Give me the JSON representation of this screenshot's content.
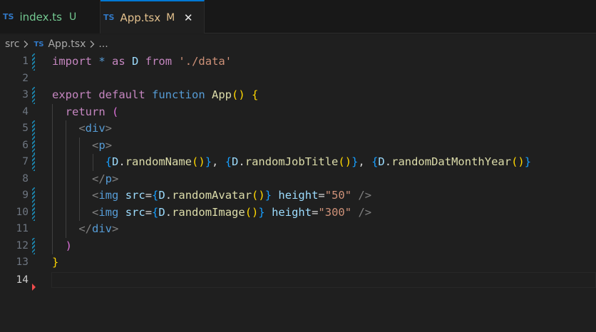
{
  "tabs": [
    {
      "badge": "TS",
      "label": "index.ts",
      "status": "U"
    },
    {
      "badge": "TS",
      "label": "App.tsx",
      "status": "M",
      "close": "✕"
    }
  ],
  "breadcrumb": {
    "folder": "src",
    "badge": "TS",
    "file": "App.tsx",
    "more": "..."
  },
  "editor": {
    "line_numbers": [
      "1",
      "2",
      "3",
      "4",
      "5",
      "6",
      "7",
      "8",
      "9",
      "10",
      "11",
      "12",
      "13",
      "14"
    ],
    "lines": [
      {
        "t": [
          "import",
          "*",
          "as",
          "D",
          "from",
          "'./data'"
        ]
      },
      {
        "t": []
      },
      {
        "t": [
          "export",
          "default",
          "function",
          "App",
          "()",
          "{"
        ]
      },
      {
        "t": [
          "return",
          "("
        ]
      },
      {
        "t": [
          "<",
          "div",
          ">"
        ]
      },
      {
        "t": [
          "<",
          "p",
          ">"
        ]
      },
      {
        "t": [
          "{",
          "D",
          ".",
          "randomName",
          "()",
          "}",
          ", ",
          "{",
          "D",
          ".",
          "randomJobTitle",
          "()",
          "}",
          ", ",
          "{",
          "D",
          ".",
          "randomDatMonthYear",
          "()",
          "}"
        ]
      },
      {
        "t": [
          "</",
          "p",
          ">"
        ]
      },
      {
        "t": [
          "<",
          "img",
          "src",
          "=",
          "{",
          "D",
          ".",
          "randomAvatar",
          "()",
          "}",
          "height",
          "=",
          "\"50\"",
          "/>"
        ]
      },
      {
        "t": [
          "<",
          "img",
          "src",
          "=",
          "{",
          "D",
          ".",
          "randomImage",
          "()",
          "}",
          "height",
          "=",
          "\"300\"",
          "/>"
        ]
      },
      {
        "t": [
          "</",
          "div",
          ">"
        ]
      },
      {
        "t": [
          ")"
        ]
      },
      {
        "t": [
          "}"
        ]
      },
      {
        "t": []
      }
    ]
  },
  "colors": {
    "accent": "#0078d4",
    "untracked": "#73c991",
    "modified": "#e2c08d",
    "ts_badge": "#3178c6"
  }
}
